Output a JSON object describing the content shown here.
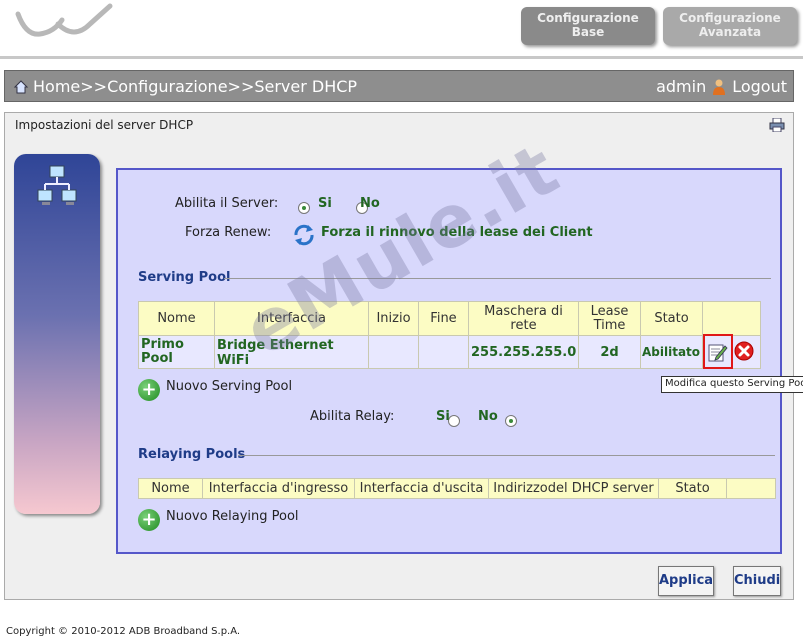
{
  "header": {
    "tabs": [
      {
        "line1": "Configurazione",
        "line2": "Base"
      },
      {
        "line1": "Configurazione",
        "line2": "Avanzata"
      }
    ]
  },
  "breadcrumb": {
    "text": "Home>>Configurazione>>Server DHCP",
    "user": "admin",
    "logout": "Logout"
  },
  "panel": {
    "title": "Impostazioni del server DHCP"
  },
  "server": {
    "enable_label": "Abilita il Server:",
    "yes": "Si",
    "no": "No",
    "renew_label": "Forza Renew:",
    "renew_link": "Forza il rinnovo della lease dei Client"
  },
  "serving_pool": {
    "title": "Serving Pool",
    "headers": [
      "Nome",
      "Interfaccia",
      "Inizio",
      "Fine",
      "Maschera di rete",
      "Lease Time",
      "Stato"
    ],
    "rows": [
      {
        "nome": "Primo Pool",
        "interfaccia": "Bridge Ethernet WiFi",
        "inizio": "",
        "fine": "",
        "maschera": "255.255.255.0",
        "lease": "2d",
        "stato": "Abilitato"
      }
    ],
    "new_label": "Nuovo Serving Pool",
    "tooltip": "Modifica questo Serving Pool",
    "relay_label": "Abilita Relay:",
    "relay_yes": "Si",
    "relay_no": "No"
  },
  "relaying_pools": {
    "title": "Relaying Pools",
    "headers": [
      "Nome",
      "Interfaccia d'ingresso",
      "Interfaccia d'uscita",
      "Indirizzodel DHCP server",
      "Stato"
    ],
    "new_label": "Nuovo Relaying Pool"
  },
  "buttons": {
    "apply": "Applica",
    "close": "Chiudi"
  },
  "watermark": "eMule.it",
  "footer": "Copyright © 2010-2012 ADB Broadband S.p.A."
}
